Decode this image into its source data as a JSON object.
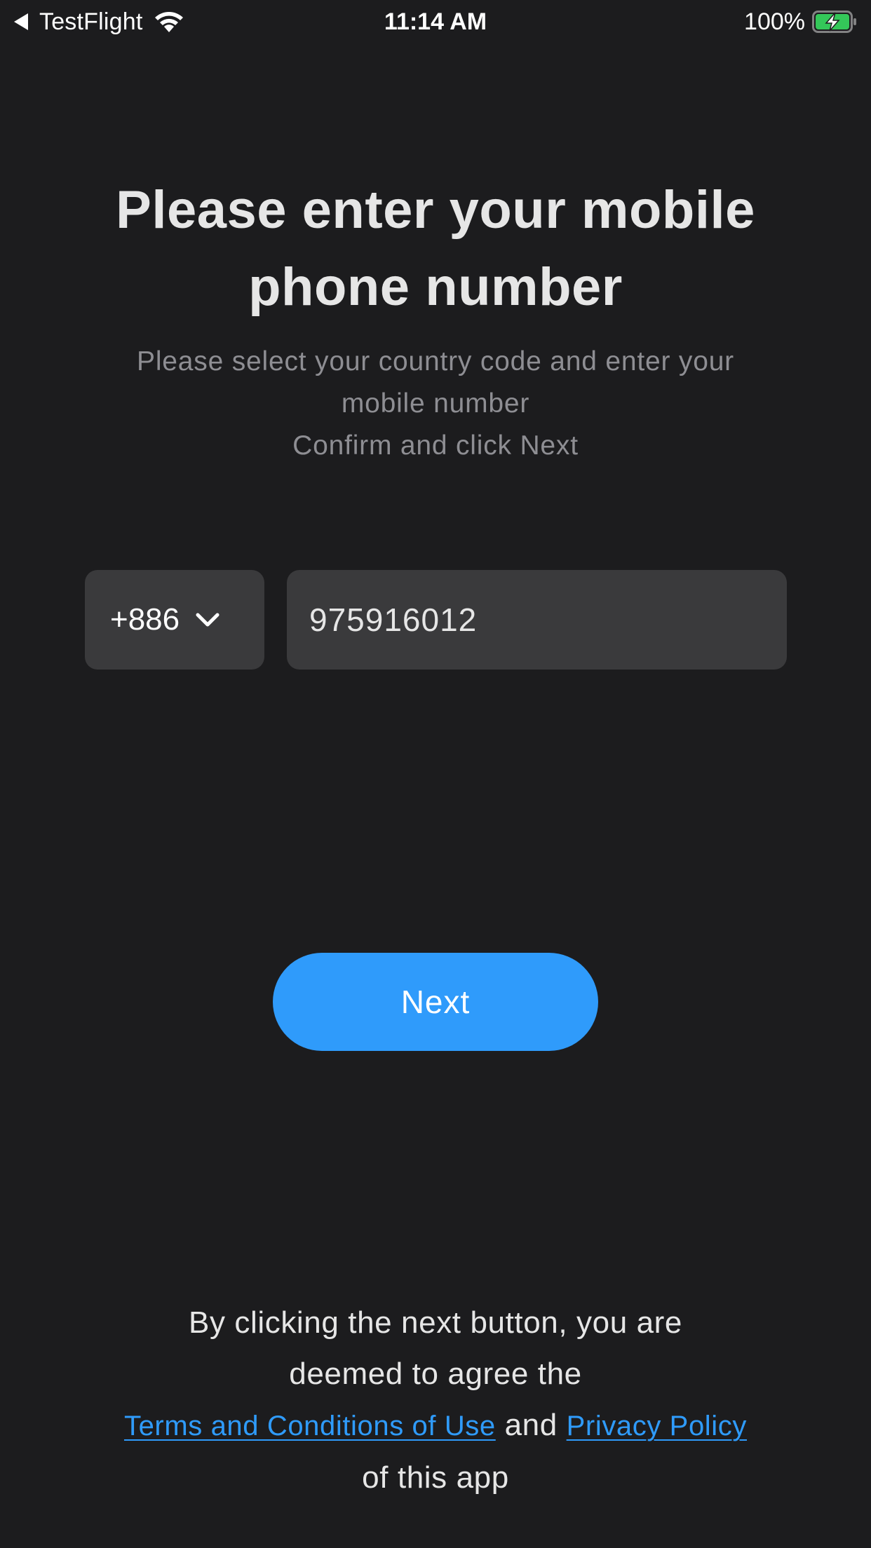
{
  "status_bar": {
    "back_app": "TestFlight",
    "time": "11:14 AM",
    "battery_percent": "100%",
    "battery_level": 1.0,
    "battery_charging": true,
    "icons": [
      "back-caret-icon",
      "wifi-icon",
      "battery-icon",
      "charging-bolt-icon"
    ]
  },
  "page": {
    "title_line1": "Please enter your mobile",
    "title_line2": "phone number",
    "subtitle_line1": "Please select your country code and enter your",
    "subtitle_line2": "mobile number",
    "subtitle_line3": "Confirm and click Next"
  },
  "form": {
    "country_code": "+886",
    "country_chevron_icon": "chevron-down-icon",
    "phone_value": "975916012"
  },
  "actions": {
    "next_label": "Next"
  },
  "legal": {
    "line1": "By clicking the next button, you are",
    "line2": "deemed to agree the",
    "terms_link": "Terms and Conditions of Use",
    "and": "and",
    "privacy_link": "Privacy Policy",
    "line4": "of this app"
  },
  "colors": {
    "background": "#1c1c1e",
    "field": "#3a3a3c",
    "accent": "#2f9bfb",
    "battery_green": "#34c759",
    "subtitle": "#8e8e93"
  }
}
